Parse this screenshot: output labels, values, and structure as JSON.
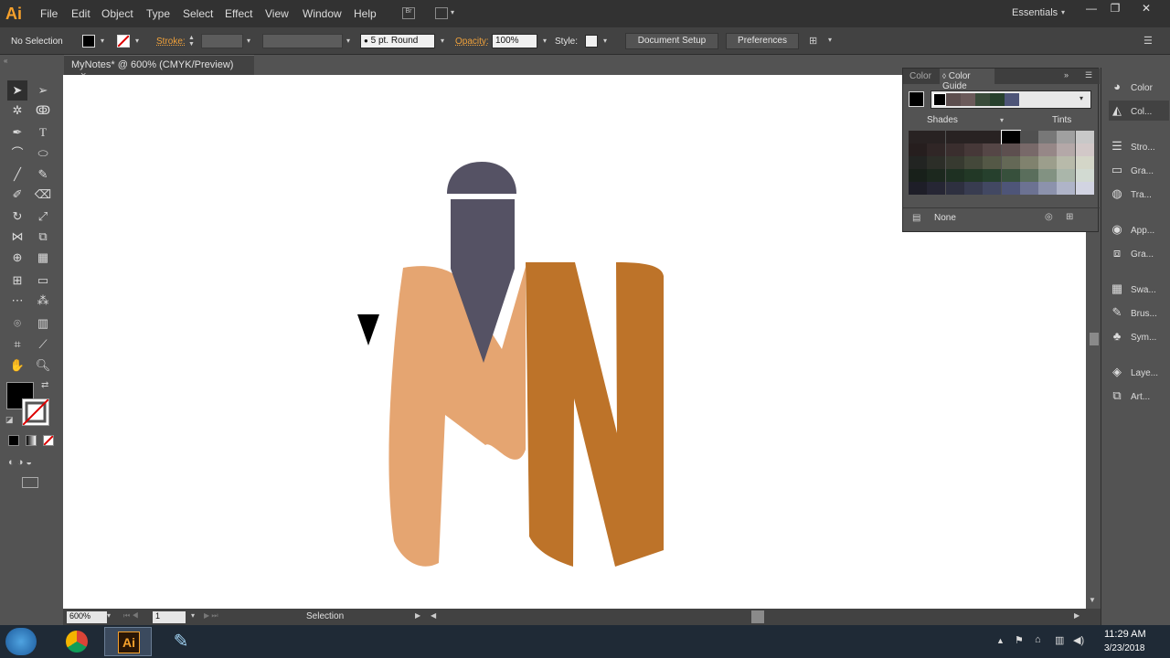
{
  "app": {
    "logo": "Ai",
    "workspace": "Essentials"
  },
  "menu": [
    "File",
    "Edit",
    "Object",
    "Type",
    "Select",
    "Effect",
    "View",
    "Window",
    "Help"
  ],
  "window_controls": {
    "minimize": "—",
    "restore": "❐",
    "close": "✕"
  },
  "control_bar": {
    "selection": "No Selection",
    "stroke_label": "Stroke:",
    "brush": "5 pt. Round",
    "opacity_label": "Opacity:",
    "opacity_value": "100%",
    "style_label": "Style:",
    "document_setup": "Document Setup",
    "preferences": "Preferences"
  },
  "document_tab": {
    "title": "MyNotes* @ 600% (CMYK/Preview)",
    "close": "×"
  },
  "color_guide": {
    "tab_color": "Color",
    "tab_color_guide": "Color Guide",
    "shades": "Shades",
    "tints": "Tints",
    "none": "None",
    "harmony_colors": [
      "#000000",
      "#5d4f4f",
      "#6b5a5a",
      "#3a4b3a",
      "#27402d",
      "#4e5578"
    ]
  },
  "dock": {
    "items": [
      "Color",
      "Col...",
      "Stro...",
      "Gra...",
      "Tra...",
      "App...",
      "Gra...",
      "Swa...",
      "Brus...",
      "Sym...",
      "Laye...",
      "Art..."
    ]
  },
  "status_bar": {
    "zoom": "600%",
    "artboard": "1",
    "mode": "Selection"
  },
  "artwork": {
    "colors": {
      "light": "#e5a571",
      "dark": "#bd7329",
      "pen": "#555264",
      "marker": "#000000"
    }
  },
  "taskbar": {
    "time": "11:29 AM",
    "date": "3/23/2018"
  }
}
